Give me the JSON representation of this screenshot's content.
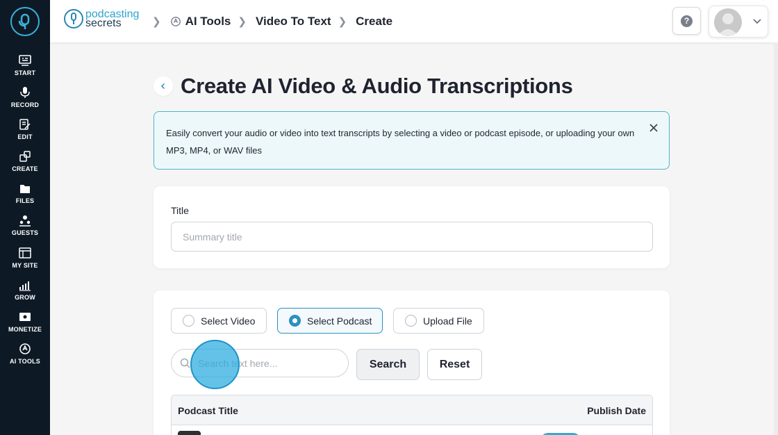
{
  "sidebar": {
    "items": [
      {
        "label": "START",
        "icon": "start-icon"
      },
      {
        "label": "RECORD",
        "icon": "mic-icon"
      },
      {
        "label": "EDIT",
        "icon": "edit-icon"
      },
      {
        "label": "CREATE",
        "icon": "create-icon"
      },
      {
        "label": "FILES",
        "icon": "files-icon"
      },
      {
        "label": "GUESTS",
        "icon": "guests-icon"
      },
      {
        "label": "MY SITE",
        "icon": "site-icon"
      },
      {
        "label": "GROW",
        "icon": "grow-icon"
      },
      {
        "label": "MONETIZE",
        "icon": "monetize-icon"
      },
      {
        "label": "AI TOOLS",
        "icon": "ai-tools-icon"
      }
    ]
  },
  "header": {
    "brand_line1": "podcasting",
    "brand_line2": "secrets",
    "breadcrumbs": [
      "AI Tools",
      "Video To Text",
      "Create"
    ],
    "help_label": "?"
  },
  "main": {
    "title": "Create AI Video & Audio Transcriptions",
    "info_text": "Easily convert your audio or video into text transcripts by selecting a video or podcast episode, or uploading your own MP3, MP4, or WAV files",
    "title_field": {
      "label": "Title",
      "placeholder": "Summary title",
      "value": ""
    },
    "options": [
      {
        "label": "Select Video",
        "selected": false
      },
      {
        "label": "Select Podcast",
        "selected": true
      },
      {
        "label": "Upload File",
        "selected": false
      }
    ],
    "search": {
      "placeholder": "Search text here...",
      "value": ""
    },
    "search_button": "Search",
    "reset_button": "Reset",
    "table": {
      "columns": [
        "Podcast Title",
        "Publish Date"
      ]
    }
  },
  "colors": {
    "sidebar_bg": "#0d1a26",
    "accent": "#2a90c0",
    "info_bg": "#edf8fa",
    "info_border": "#4fb3c9"
  }
}
